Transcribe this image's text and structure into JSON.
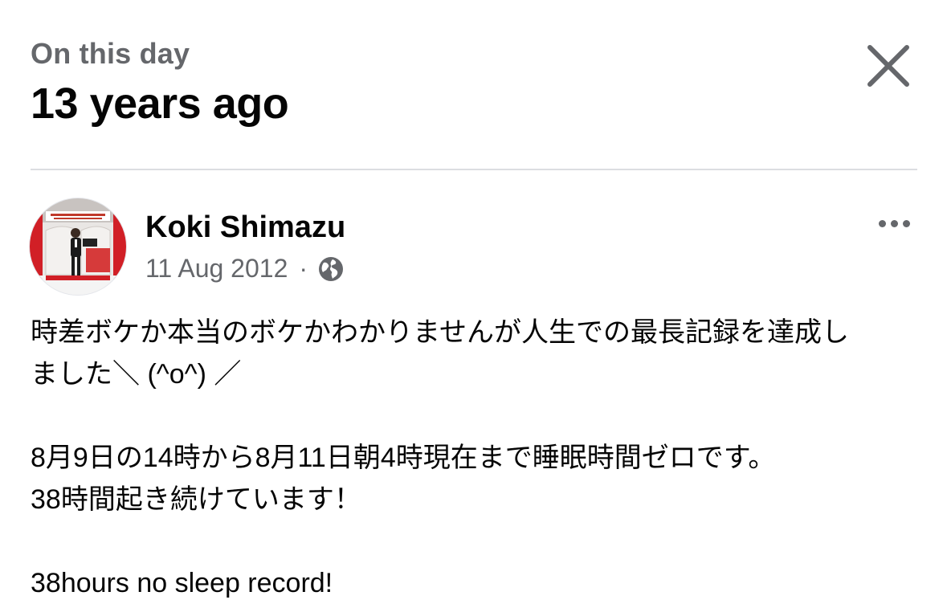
{
  "header": {
    "subtitle": "On this day",
    "title": "13 years ago"
  },
  "post": {
    "author": "Koki Shimazu",
    "date": "11 Aug 2012",
    "separator": "·",
    "privacy_icon": "globe-icon",
    "paragraphs": [
      {
        "lines": [
          "時差ボケか本当のボケかわかりませんが人生での最長記録を達成し",
          "ました＼ (^o^) ／"
        ]
      },
      {
        "lines": [
          "8月9日の14時から8月11日朝4時現在まで睡眠時間ゼロです。",
          "38時間起き続けています！"
        ]
      },
      {
        "lines": [
          "38hours no sleep record!"
        ]
      }
    ]
  },
  "icons": {
    "close": "close-icon",
    "more": "more-options-icon",
    "avatar": "avatar"
  },
  "colors": {
    "text_primary": "#050505",
    "text_secondary": "#65676b",
    "divider": "#dcdde1"
  }
}
